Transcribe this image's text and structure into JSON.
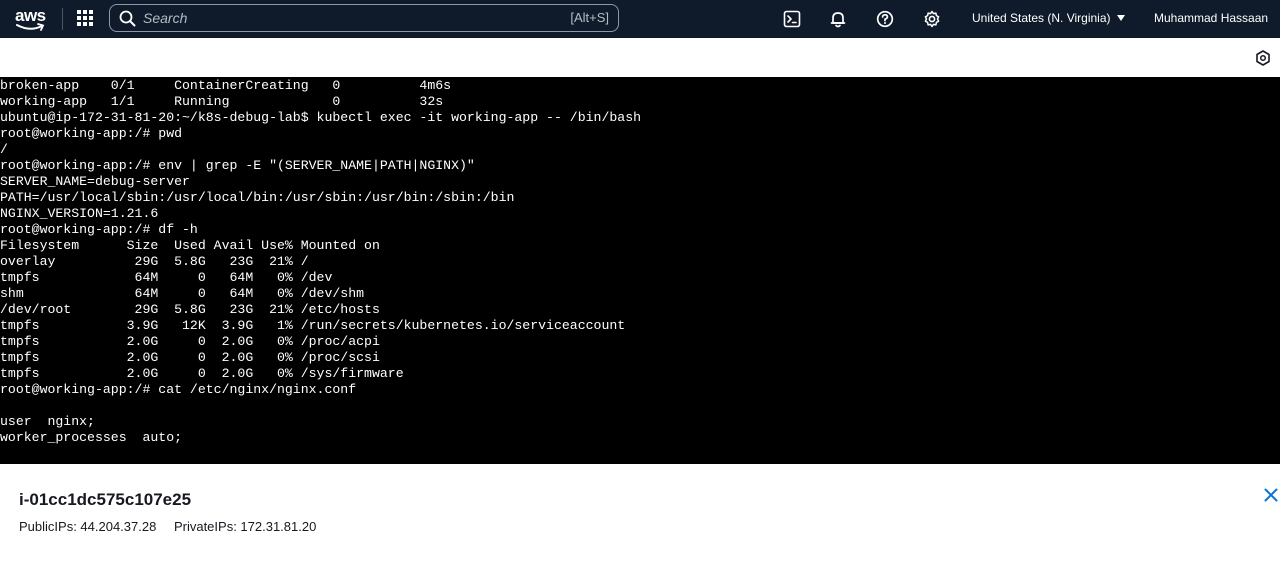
{
  "nav": {
    "logo_text": "aws",
    "search_placeholder": "Search",
    "search_shortcut": "[Alt+S]",
    "region": "United States (N. Virginia)",
    "user": "Muhammad Hassaan",
    "icons": [
      "grid-icon",
      "search-icon",
      "cloudshell-icon",
      "bell-icon",
      "help-icon",
      "gear-icon"
    ]
  },
  "terminal": {
    "lines": [
      "broken-app    0/1     ContainerCreating   0          4m6s",
      "working-app   1/1     Running             0          32s",
      "ubuntu@ip-172-31-81-20:~/k8s-debug-lab$ kubectl exec -it working-app -- /bin/bash",
      "root@working-app:/# pwd",
      "/",
      "root@working-app:/# env | grep -E \"(SERVER_NAME|PATH|NGINX)\"",
      "SERVER_NAME=debug-server",
      "PATH=/usr/local/sbin:/usr/local/bin:/usr/sbin:/usr/bin:/sbin:/bin",
      "NGINX_VERSION=1.21.6",
      "root@working-app:/# df -h",
      "Filesystem      Size  Used Avail Use% Mounted on",
      "overlay          29G  5.8G   23G  21% /",
      "tmpfs            64M     0   64M   0% /dev",
      "shm              64M     0   64M   0% /dev/shm",
      "/dev/root        29G  5.8G   23G  21% /etc/hosts",
      "tmpfs           3.9G   12K  3.9G   1% /run/secrets/kubernetes.io/serviceaccount",
      "tmpfs           2.0G     0  2.0G   0% /proc/acpi",
      "tmpfs           2.0G     0  2.0G   0% /proc/scsi",
      "tmpfs           2.0G     0  2.0G   0% /sys/firmware",
      "root@working-app:/# cat /etc/nginx/nginx.conf",
      "",
      "user  nginx;",
      "worker_processes  auto;"
    ]
  },
  "instance": {
    "id": "i-01cc1dc575c107e25",
    "public_ips": "PublicIPs: 44.204.37.28",
    "private_ips": "PrivateIPs: 172.31.81.20"
  },
  "colors": {
    "nav_bg": "#0f1b2a",
    "terminal_bg": "#000000",
    "terminal_fg": "#ffffff",
    "close_blue": "#0972d3"
  }
}
